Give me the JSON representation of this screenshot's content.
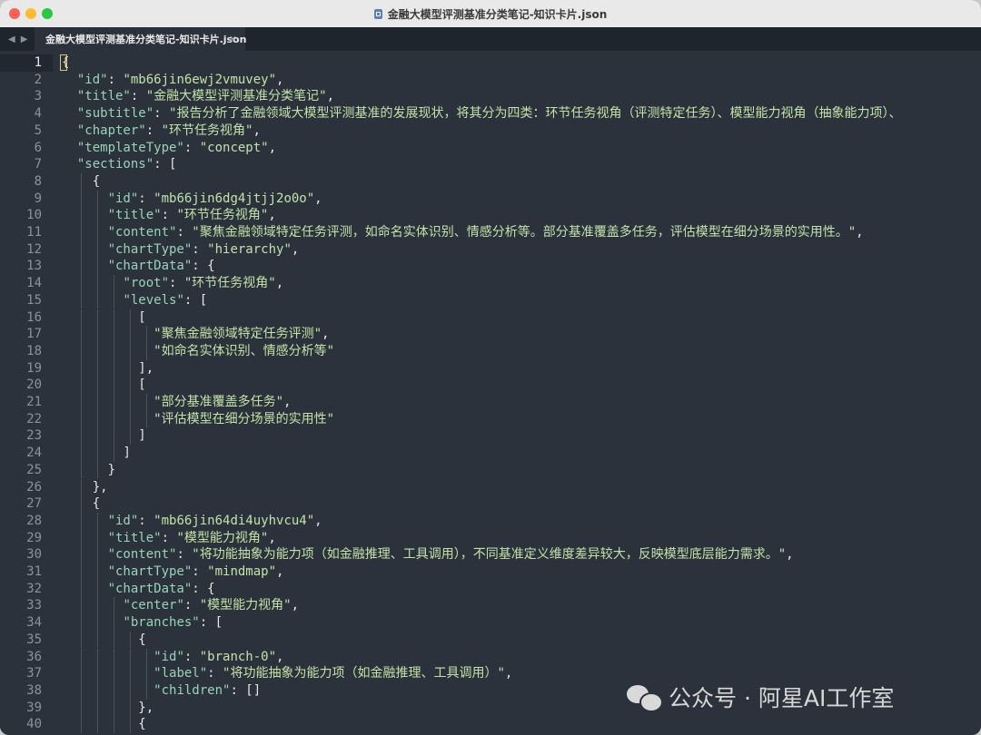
{
  "window": {
    "title": "金融大模型评测基准分类笔记-知识卡片.json",
    "file_icon": "json-file-icon"
  },
  "tabbar": {
    "back_arrow": "◀",
    "forward_arrow": "▶",
    "tab_label": "金融大模型评测基准分类笔记-知识卡片.json",
    "tab_close": "×"
  },
  "editor": {
    "active_line": 1,
    "lines": [
      {
        "n": "1",
        "indent": 0,
        "t": [
          [
            "p",
            "{"
          ]
        ]
      },
      {
        "n": "2",
        "indent": 1,
        "t": [
          [
            "k",
            "\"id\""
          ],
          [
            "p",
            ": "
          ],
          [
            "s",
            "\"mb66jin6ewj2vmuvey\""
          ],
          [
            "p",
            ","
          ]
        ]
      },
      {
        "n": "3",
        "indent": 1,
        "t": [
          [
            "k",
            "\"title\""
          ],
          [
            "p",
            ": "
          ],
          [
            "s",
            "\"金融大模型评测基准分类笔记\""
          ],
          [
            "p",
            ","
          ]
        ]
      },
      {
        "n": "4",
        "indent": 1,
        "t": [
          [
            "k",
            "\"subtitle\""
          ],
          [
            "p",
            ": "
          ],
          [
            "s",
            "\"报告分析了金融领域大模型评测基准的发展现状，将其分为四类：环节任务视角（评测特定任务）、模型能力视角（抽象能力项）、"
          ]
        ]
      },
      {
        "n": "5",
        "indent": 1,
        "t": [
          [
            "k",
            "\"chapter\""
          ],
          [
            "p",
            ": "
          ],
          [
            "s",
            "\"环节任务视角\""
          ],
          [
            "p",
            ","
          ]
        ]
      },
      {
        "n": "6",
        "indent": 1,
        "t": [
          [
            "k",
            "\"templateType\""
          ],
          [
            "p",
            ": "
          ],
          [
            "s",
            "\"concept\""
          ],
          [
            "p",
            ","
          ]
        ]
      },
      {
        "n": "7",
        "indent": 1,
        "t": [
          [
            "k",
            "\"sections\""
          ],
          [
            "p",
            ": ["
          ]
        ]
      },
      {
        "n": "8",
        "indent": 2,
        "t": [
          [
            "p",
            "{"
          ]
        ]
      },
      {
        "n": "9",
        "indent": 3,
        "t": [
          [
            "k",
            "\"id\""
          ],
          [
            "p",
            ": "
          ],
          [
            "s",
            "\"mb66jin6dg4jtjj2o0o\""
          ],
          [
            "p",
            ","
          ]
        ]
      },
      {
        "n": "10",
        "indent": 3,
        "t": [
          [
            "k",
            "\"title\""
          ],
          [
            "p",
            ": "
          ],
          [
            "s",
            "\"环节任务视角\""
          ],
          [
            "p",
            ","
          ]
        ]
      },
      {
        "n": "11",
        "indent": 3,
        "t": [
          [
            "k",
            "\"content\""
          ],
          [
            "p",
            ": "
          ],
          [
            "s",
            "\"聚焦金融领域特定任务评测，如命名实体识别、情感分析等。部分基准覆盖多任务，评估模型在细分场景的实用性。\""
          ],
          [
            "p",
            ","
          ]
        ]
      },
      {
        "n": "12",
        "indent": 3,
        "t": [
          [
            "k",
            "\"chartType\""
          ],
          [
            "p",
            ": "
          ],
          [
            "s",
            "\"hierarchy\""
          ],
          [
            "p",
            ","
          ]
        ]
      },
      {
        "n": "13",
        "indent": 3,
        "t": [
          [
            "k",
            "\"chartData\""
          ],
          [
            "p",
            ": {"
          ]
        ]
      },
      {
        "n": "14",
        "indent": 4,
        "t": [
          [
            "k",
            "\"root\""
          ],
          [
            "p",
            ": "
          ],
          [
            "s",
            "\"环节任务视角\""
          ],
          [
            "p",
            ","
          ]
        ]
      },
      {
        "n": "15",
        "indent": 4,
        "t": [
          [
            "k",
            "\"levels\""
          ],
          [
            "p",
            ": ["
          ]
        ]
      },
      {
        "n": "16",
        "indent": 5,
        "t": [
          [
            "p",
            "["
          ]
        ]
      },
      {
        "n": "17",
        "indent": 6,
        "t": [
          [
            "s",
            "\"聚焦金融领域特定任务评测\""
          ],
          [
            "p",
            ","
          ]
        ]
      },
      {
        "n": "18",
        "indent": 6,
        "t": [
          [
            "s",
            "\"如命名实体识别、情感分析等\""
          ]
        ]
      },
      {
        "n": "19",
        "indent": 5,
        "t": [
          [
            "p",
            "],"
          ]
        ]
      },
      {
        "n": "20",
        "indent": 5,
        "t": [
          [
            "p",
            "["
          ]
        ]
      },
      {
        "n": "21",
        "indent": 6,
        "t": [
          [
            "s",
            "\"部分基准覆盖多任务\""
          ],
          [
            "p",
            ","
          ]
        ]
      },
      {
        "n": "22",
        "indent": 6,
        "t": [
          [
            "s",
            "\"评估模型在细分场景的实用性\""
          ]
        ]
      },
      {
        "n": "23",
        "indent": 5,
        "t": [
          [
            "p",
            "]"
          ]
        ]
      },
      {
        "n": "24",
        "indent": 4,
        "t": [
          [
            "p",
            "]"
          ]
        ]
      },
      {
        "n": "25",
        "indent": 3,
        "t": [
          [
            "p",
            "}"
          ]
        ]
      },
      {
        "n": "26",
        "indent": 2,
        "t": [
          [
            "p",
            "},"
          ]
        ]
      },
      {
        "n": "27",
        "indent": 2,
        "t": [
          [
            "p",
            "{"
          ]
        ]
      },
      {
        "n": "28",
        "indent": 3,
        "t": [
          [
            "k",
            "\"id\""
          ],
          [
            "p",
            ": "
          ],
          [
            "s",
            "\"mb66jin64di4uyhvcu4\""
          ],
          [
            "p",
            ","
          ]
        ]
      },
      {
        "n": "29",
        "indent": 3,
        "t": [
          [
            "k",
            "\"title\""
          ],
          [
            "p",
            ": "
          ],
          [
            "s",
            "\"模型能力视角\""
          ],
          [
            "p",
            ","
          ]
        ]
      },
      {
        "n": "30",
        "indent": 3,
        "t": [
          [
            "k",
            "\"content\""
          ],
          [
            "p",
            ": "
          ],
          [
            "s",
            "\"将功能抽象为能力项（如金融推理、工具调用），不同基准定义维度差异较大，反映模型底层能力需求。\""
          ],
          [
            "p",
            ","
          ]
        ]
      },
      {
        "n": "31",
        "indent": 3,
        "t": [
          [
            "k",
            "\"chartType\""
          ],
          [
            "p",
            ": "
          ],
          [
            "s",
            "\"mindmap\""
          ],
          [
            "p",
            ","
          ]
        ]
      },
      {
        "n": "32",
        "indent": 3,
        "t": [
          [
            "k",
            "\"chartData\""
          ],
          [
            "p",
            ": {"
          ]
        ]
      },
      {
        "n": "33",
        "indent": 4,
        "t": [
          [
            "k",
            "\"center\""
          ],
          [
            "p",
            ": "
          ],
          [
            "s",
            "\"模型能力视角\""
          ],
          [
            "p",
            ","
          ]
        ]
      },
      {
        "n": "34",
        "indent": 4,
        "t": [
          [
            "k",
            "\"branches\""
          ],
          [
            "p",
            ": ["
          ]
        ]
      },
      {
        "n": "35",
        "indent": 5,
        "t": [
          [
            "p",
            "{"
          ]
        ]
      },
      {
        "n": "36",
        "indent": 6,
        "t": [
          [
            "k",
            "\"id\""
          ],
          [
            "p",
            ": "
          ],
          [
            "s",
            "\"branch-0\""
          ],
          [
            "p",
            ","
          ]
        ]
      },
      {
        "n": "37",
        "indent": 6,
        "t": [
          [
            "k",
            "\"label\""
          ],
          [
            "p",
            ": "
          ],
          [
            "s",
            "\"将功能抽象为能力项（如金融推理、工具调用）\""
          ],
          [
            "p",
            ","
          ]
        ]
      },
      {
        "n": "38",
        "indent": 6,
        "t": [
          [
            "k",
            "\"children\""
          ],
          [
            "p",
            ": []"
          ]
        ]
      },
      {
        "n": "39",
        "indent": 5,
        "t": [
          [
            "p",
            "},"
          ]
        ]
      },
      {
        "n": "40",
        "indent": 5,
        "t": [
          [
            "p",
            "{"
          ]
        ]
      }
    ]
  },
  "watermark": {
    "text": "公众号 · 阿星AI工作室",
    "icon": "wechat-icon"
  },
  "colors": {
    "editor_bg": "#2b323b",
    "key": "#98d4b8",
    "string": "#c3e2a8",
    "punctuation": "#e6e6e6",
    "line_number": "#8a929c"
  }
}
